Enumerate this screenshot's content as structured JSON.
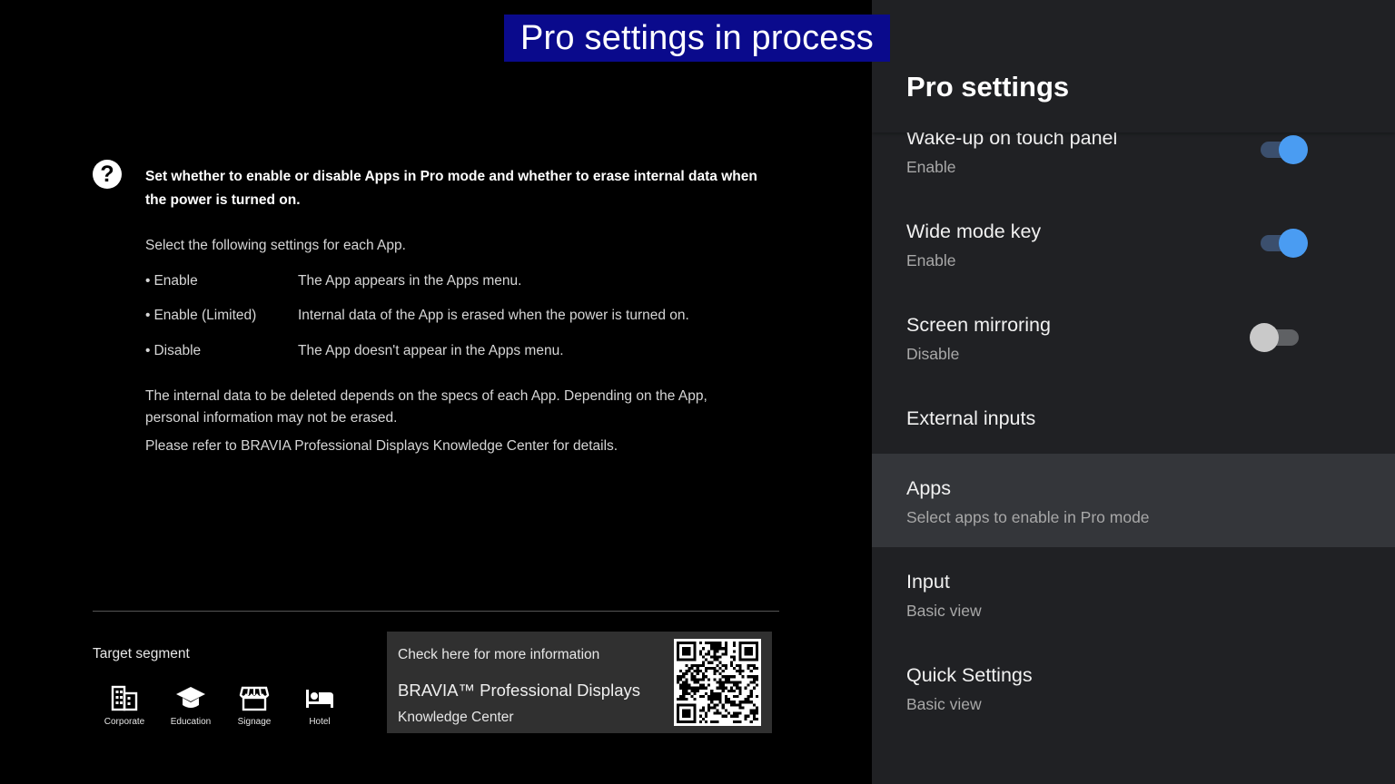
{
  "banner": {
    "text": "Pro settings in process"
  },
  "help": {
    "title": "Set whether to enable or disable Apps in Pro mode and whether to erase internal data when the power is turned on.",
    "intro": "Select the following settings for each App.",
    "options": [
      {
        "name": "Enable",
        "desc": "The App appears in the Apps menu."
      },
      {
        "name": "Enable (Limited)",
        "desc": "Internal data of the App is erased when the power is turned on."
      },
      {
        "name": "Disable",
        "desc": "The App doesn't appear in the Apps menu."
      }
    ],
    "note1": "The internal data to be deleted depends on the specs of each App. Depending on the App, personal information may not be erased.",
    "note2": "Please refer to BRAVIA Professional Displays Knowledge Center for details.",
    "bullet": "•"
  },
  "target": {
    "label": "Target segment",
    "segments": [
      {
        "label": "Corporate",
        "icon": "building-icon"
      },
      {
        "label": "Education",
        "icon": "graduation-cap-icon"
      },
      {
        "label": "Signage",
        "icon": "storefront-icon"
      },
      {
        "label": "Hotel",
        "icon": "bed-icon"
      }
    ]
  },
  "info": {
    "check": "Check here for more information",
    "brand": "BRAVIA™ Professional Displays",
    "kc": "Knowledge Center",
    "qr_icon": "qr-code-icon"
  },
  "panel": {
    "title": "Pro settings",
    "items": [
      {
        "title": "Wake-up on touch panel",
        "sub": "Enable",
        "toggle": true
      },
      {
        "title": "Wide mode key",
        "sub": "Enable",
        "toggle": true
      },
      {
        "title": "Screen mirroring",
        "sub": "Disable",
        "toggle": false
      },
      {
        "title": "External inputs",
        "sub": ""
      },
      {
        "title": "Apps",
        "sub": "Select apps to enable in Pro mode",
        "selected": true
      },
      {
        "title": "Input",
        "sub": "Basic view"
      },
      {
        "title": "Quick Settings",
        "sub": "Basic view"
      }
    ]
  },
  "colors": {
    "banner": "#0a0a8c",
    "panel": "#202124",
    "selected_row": "#34363a",
    "toggle_on": "#4a9cf2"
  }
}
